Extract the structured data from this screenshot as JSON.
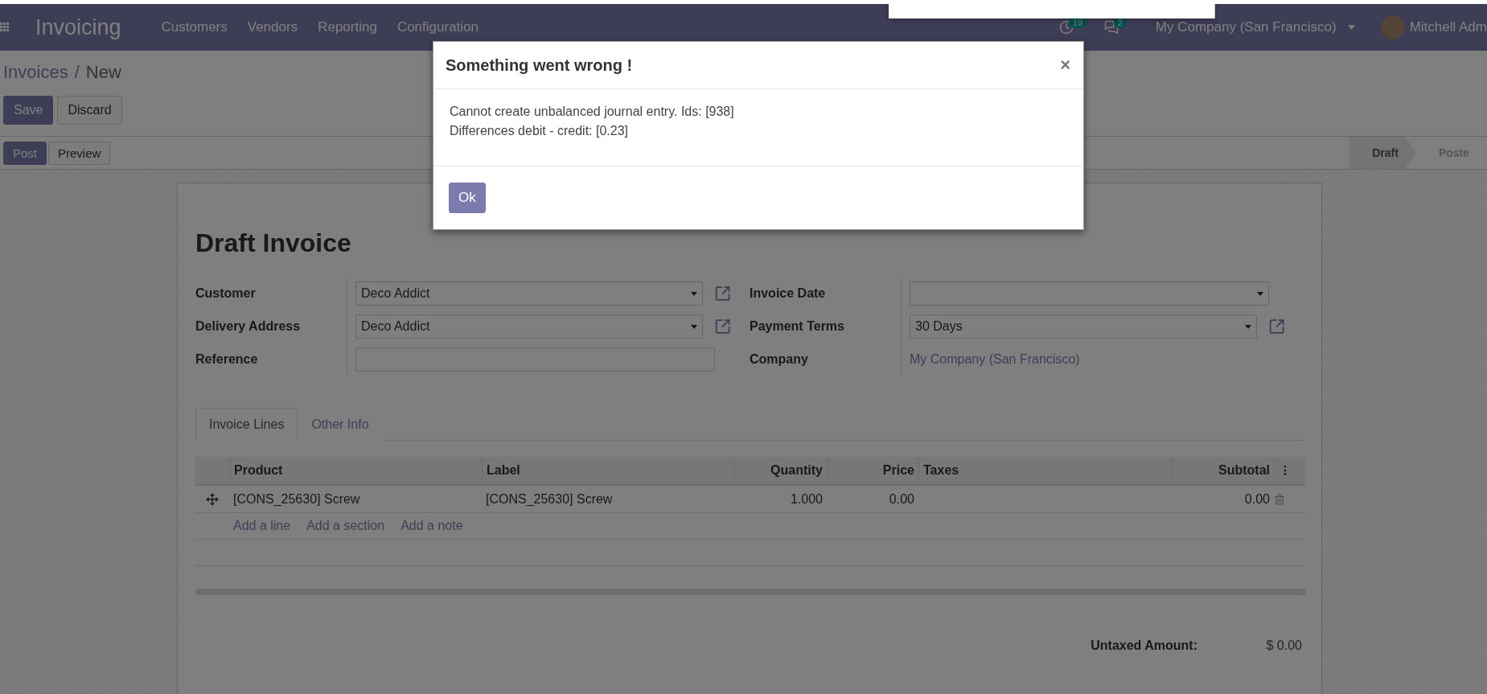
{
  "navbar": {
    "app_title": "Invoicing",
    "menu": [
      "Customers",
      "Vendors",
      "Reporting",
      "Configuration"
    ],
    "activity_count": "19",
    "message_count": "2",
    "company": "My Company (San Francisco)",
    "user": "Mitchell Adm"
  },
  "breadcrumb": {
    "parent": "Invoices",
    "separator": "/",
    "current": "New"
  },
  "form_buttons": [
    {
      "label": "Save",
      "kind": "primary"
    },
    {
      "label": "Discard",
      "kind": "secondary"
    }
  ],
  "action_buttons": [
    {
      "label": "Post",
      "kind": "primary"
    },
    {
      "label": "Preview",
      "kind": "secondary"
    }
  ],
  "status_bar": [
    {
      "label": "Draft",
      "selected": true
    },
    {
      "label": "Poste",
      "selected": false
    }
  ],
  "sheet": {
    "title": "Draft Invoice",
    "left_fields": [
      {
        "label": "Customer",
        "kind": "select",
        "value": "Deco Addict",
        "link": true
      },
      {
        "label": "Delivery Address",
        "kind": "select",
        "value": "Deco Addict",
        "link": true
      },
      {
        "label": "Reference",
        "kind": "input",
        "link": false
      }
    ],
    "right_fields": [
      {
        "label": "Invoice Date",
        "kind": "select",
        "link": false
      },
      {
        "label": "Payment Terms",
        "kind": "select",
        "value": "30 Days",
        "link": true
      },
      {
        "label": "Company",
        "kind": "text",
        "value": "My Company (San Francisco)",
        "link": false
      }
    ],
    "tabs": [
      {
        "label": "Invoice Lines",
        "selected": true
      },
      {
        "label": "Other Info",
        "selected": false
      }
    ],
    "table": {
      "columns": [
        "Product",
        "Label",
        "Quantity",
        "Price",
        "Taxes",
        "Subtotal"
      ],
      "rows": [
        {
          "product": "[CONS_25630] Screw",
          "label": "[CONS_25630] Screw",
          "quantity": "1.000",
          "price": "0.00",
          "subtotal": "0.00"
        }
      ],
      "add_links": [
        "Add a line",
        "Add a section",
        "Add a note"
      ]
    },
    "totals": [
      {
        "label": "Untaxed Amount:",
        "value": "$ 0.00"
      }
    ]
  },
  "dialog": {
    "title": "Something went wrong !",
    "close": "×",
    "message_lines": [
      "Cannot create unbalanced journal entry. Ids: [938]",
      "Differences debit - credit: [0.23]"
    ],
    "button": "Ok"
  }
}
